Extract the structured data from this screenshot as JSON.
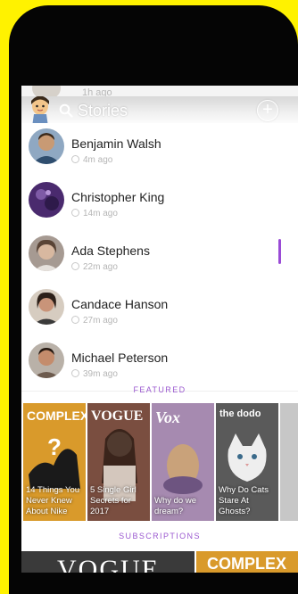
{
  "header": {
    "title": "Stories"
  },
  "ghost_row": {
    "time": "1h ago"
  },
  "stories": [
    {
      "name": "Benjamin Walsh",
      "time": "4m ago"
    },
    {
      "name": "Christopher King",
      "time": "14m ago"
    },
    {
      "name": "Ada Stephens",
      "time": "22m ago"
    },
    {
      "name": "Candace Hanson",
      "time": "27m ago"
    },
    {
      "name": "Michael Peterson",
      "time": "39m ago"
    }
  ],
  "sections": {
    "featured": "FEATURED",
    "subscriptions": "SUBSCRIPTIONS"
  },
  "featured": [
    {
      "logo": "COMPLEX",
      "caption": "14 Things You Never Knew About Nike",
      "color": "#d99a2b"
    },
    {
      "logo": "VOGUE",
      "caption": "5 Single Girl Secrets for 2017",
      "color": "#8a5a4a"
    },
    {
      "logo": "Vox",
      "caption": "Why do we dream?",
      "color": "#9b7ea8"
    },
    {
      "logo": "the dodo",
      "caption": "Why Do Cats Stare At Ghosts?",
      "color": "#6b6b6b"
    }
  ],
  "subscriptions": [
    {
      "logo": "VOGUE"
    },
    {
      "logo": "COMPLEX"
    }
  ],
  "colors": {
    "accent": "#9b59d0",
    "background": "#FFF200"
  }
}
